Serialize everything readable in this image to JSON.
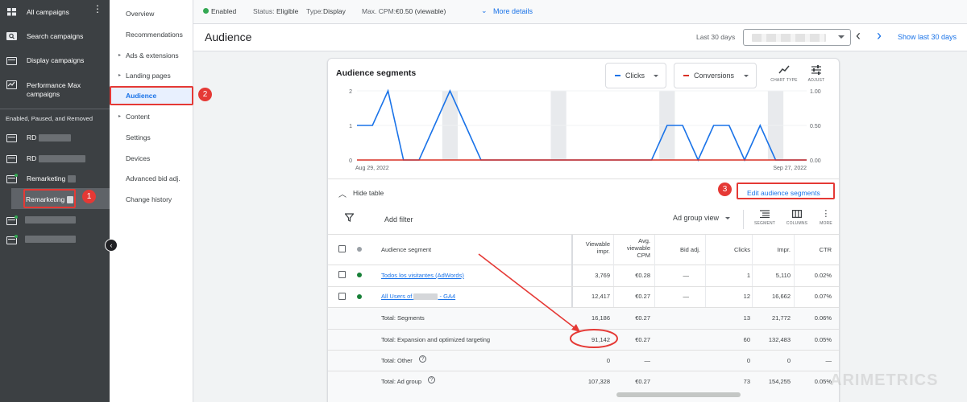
{
  "leftnav": {
    "all_campaigns": "All campaigns",
    "search_campaigns": "Search campaigns",
    "display_campaigns": "Display campaigns",
    "pmax_line1": "Performance Max",
    "pmax_line2": "campaigns",
    "section_label": "Enabled, Paused, and Removed",
    "rd1": "RD",
    "rd2": "RD",
    "remarketing": "Remarketing",
    "remarketing_sub": "Remarketing"
  },
  "subnav": {
    "overview": "Overview",
    "recommendations": "Recommendations",
    "ads_extensions": "Ads & extensions",
    "landing_pages": "Landing pages",
    "audience": "Audience",
    "content": "Content",
    "settings": "Settings",
    "devices": "Devices",
    "advanced_bid": "Advanced bid adj.",
    "change_history": "Change history"
  },
  "statusbar": {
    "enabled": "Enabled",
    "status_label": "Status:",
    "status_value": "Eligible",
    "type_label": "Type:",
    "type_value": "Display",
    "cpm_label": "Max. CPM:",
    "cpm_value": "€0.50 (viewable)",
    "more_details": "More details"
  },
  "titlebar": {
    "title": "Audience",
    "last30": "Last 30 days",
    "show_last": "Show last 30 days"
  },
  "card": {
    "title": "Audience segments",
    "metric1": "Clicks",
    "metric2": "Conversions",
    "chart_type": "CHART TYPE",
    "adjust": "ADJUST",
    "hide_table": "Hide table",
    "edit_segments": "Edit audience segments",
    "add_filter": "Add filter",
    "ad_group_view": "Ad group view",
    "segment": "SEGMENT",
    "columns": "COLUMNS",
    "more": "MORE"
  },
  "colors": {
    "clicks": "#1a73e8",
    "conversions": "#d93025",
    "accent": "#1a73e8",
    "annotation": "#e53935"
  },
  "chart_data": {
    "type": "line",
    "x_start": "Aug 29, 2022",
    "x_end": "Sep 27, 2022",
    "y_left_ticks": [
      "0",
      "1",
      "2"
    ],
    "y_right_ticks": [
      "0.00",
      "0.50",
      "1.00"
    ],
    "ylim_left": [
      0,
      2
    ],
    "ylim_right": [
      0,
      1
    ],
    "series": [
      {
        "name": "Clicks",
        "axis": "left",
        "values": [
          1,
          1,
          2,
          0,
          0,
          1,
          2,
          1,
          0,
          0,
          0,
          0,
          0,
          0,
          0,
          0,
          0,
          0,
          0,
          0,
          1,
          1,
          0,
          1,
          1,
          0,
          1,
          0,
          0,
          0
        ]
      },
      {
        "name": "Conversions",
        "axis": "right",
        "values": [
          0,
          0,
          0,
          0,
          0,
          0,
          0,
          0,
          0,
          0,
          0,
          0,
          0,
          0,
          0,
          0,
          0,
          0,
          0,
          0,
          0,
          0,
          0,
          0,
          0,
          0,
          0,
          0,
          0,
          0
        ]
      }
    ],
    "weekend_band_indices": [
      6,
      13,
      20,
      27
    ]
  },
  "table": {
    "headers": {
      "segment": "Audience segment",
      "viewable1": "Viewable",
      "viewable2": "impr.",
      "avg1": "Avg.",
      "avg2": "viewable",
      "avg3": "CPM",
      "bid": "Bid adj.",
      "clicks": "Clicks",
      "impr": "Impr.",
      "ctr": "CTR"
    },
    "rows": [
      {
        "segment": "Todos los visitantes (AdWords)",
        "viewable": "3,769",
        "cpm": "€0.28",
        "bid": "—",
        "clicks": "1",
        "impr": "5,110",
        "ctr": "0.02%"
      },
      {
        "segment_prefix": "All Users of",
        "segment_suffix": "- GA4",
        "viewable": "12,417",
        "cpm": "€0.27",
        "bid": "—",
        "clicks": "12",
        "impr": "16,662",
        "ctr": "0.07%"
      }
    ],
    "totals": [
      {
        "label": "Total: Segments",
        "viewable": "16,186",
        "cpm": "€0.27",
        "clicks": "13",
        "impr": "21,772",
        "ctr": "0.06%"
      },
      {
        "label": "Total: Expansion and optimized targeting",
        "viewable": "91,142",
        "cpm": "€0.27",
        "clicks": "60",
        "impr": "132,483",
        "ctr": "0.05%"
      },
      {
        "label": "Total: Other",
        "viewable": "0",
        "cpm": "—",
        "clicks": "0",
        "impr": "0",
        "ctr": "—"
      },
      {
        "label": "Total: Ad group",
        "viewable": "107,328",
        "cpm": "€0.27",
        "clicks": "73",
        "impr": "154,255",
        "ctr": "0.05%"
      }
    ]
  },
  "annotations": {
    "one": "1",
    "two": "2",
    "three": "3"
  },
  "watermark": "ARIMETRICS"
}
